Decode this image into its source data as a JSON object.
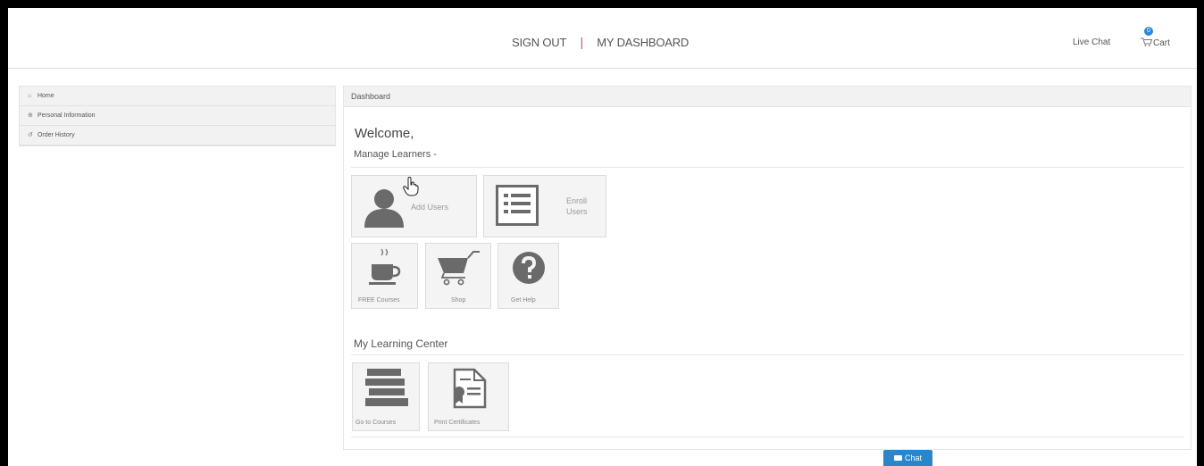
{
  "header": {
    "sign_out": "SIGN OUT",
    "separator": "|",
    "dashboard": "MY DASHBOARD",
    "live_chat": "Live Chat",
    "cart_count": "0",
    "cart": "Cart"
  },
  "sidebar": {
    "items": [
      {
        "label": "Home",
        "icon": "home-icon"
      },
      {
        "label": "Personal Information",
        "icon": "user-icon"
      },
      {
        "label": "Order History",
        "icon": "history-icon"
      }
    ]
  },
  "main": {
    "panel_title": "Dashboard",
    "welcome": "Welcome,",
    "manage_title": "Manage Learners -",
    "tiles_manage": {
      "add_users": "Add Users",
      "enroll_line1": "Enroll",
      "enroll_line2": "Users"
    },
    "tiles_small": {
      "free_courses": "FREE Courses",
      "shop": "Shop",
      "get_help": "Get Help"
    },
    "learning_title": "My Learning Center",
    "tiles_learning": {
      "go_to_courses": "Go to Courses",
      "print_certificates": "Print Certificates"
    }
  },
  "chat_button": "Chat",
  "colors": {
    "accent": "#2b86c9",
    "separator_red": "#d9534f",
    "tile_bg": "#f4f4f4",
    "icon_gray": "#6a6a6a"
  }
}
